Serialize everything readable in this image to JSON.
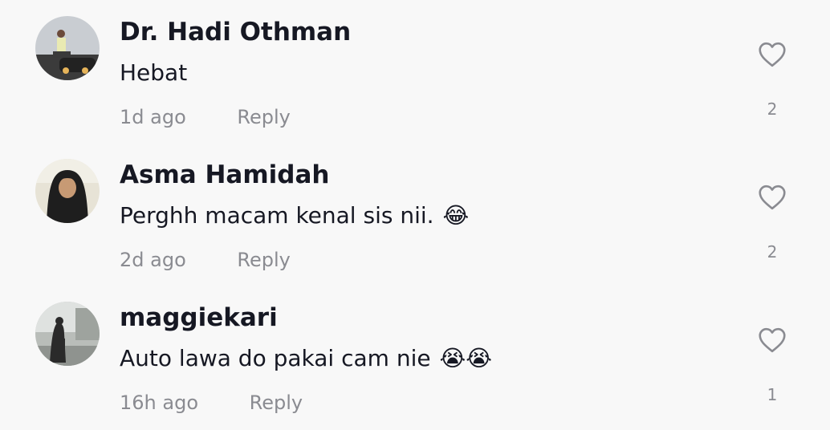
{
  "comments": [
    {
      "username": "Dr. Hadi Othman",
      "text": "Hebat",
      "emoji": "",
      "time": "1d ago",
      "reply_label": "Reply",
      "like_count": "2",
      "avatar": "photo-man-car"
    },
    {
      "username": "Asma Hamidah",
      "text": "Perghh macam kenal sis nii.",
      "emoji": "😂",
      "time": "2d ago",
      "reply_label": "Reply",
      "like_count": "2",
      "avatar": "photo-woman-hijab"
    },
    {
      "username": "maggiekari",
      "text": "Auto lawa do pakai cam nie",
      "emoji": "😭😭",
      "time": "16h ago",
      "reply_label": "Reply",
      "like_count": "1",
      "avatar": "photo-woman-walking"
    }
  ],
  "icons": {
    "like": "heart-outline-icon"
  },
  "colors": {
    "background": "#f8f8f8",
    "text_primary": "#161823",
    "text_secondary": "#8a8b91"
  }
}
